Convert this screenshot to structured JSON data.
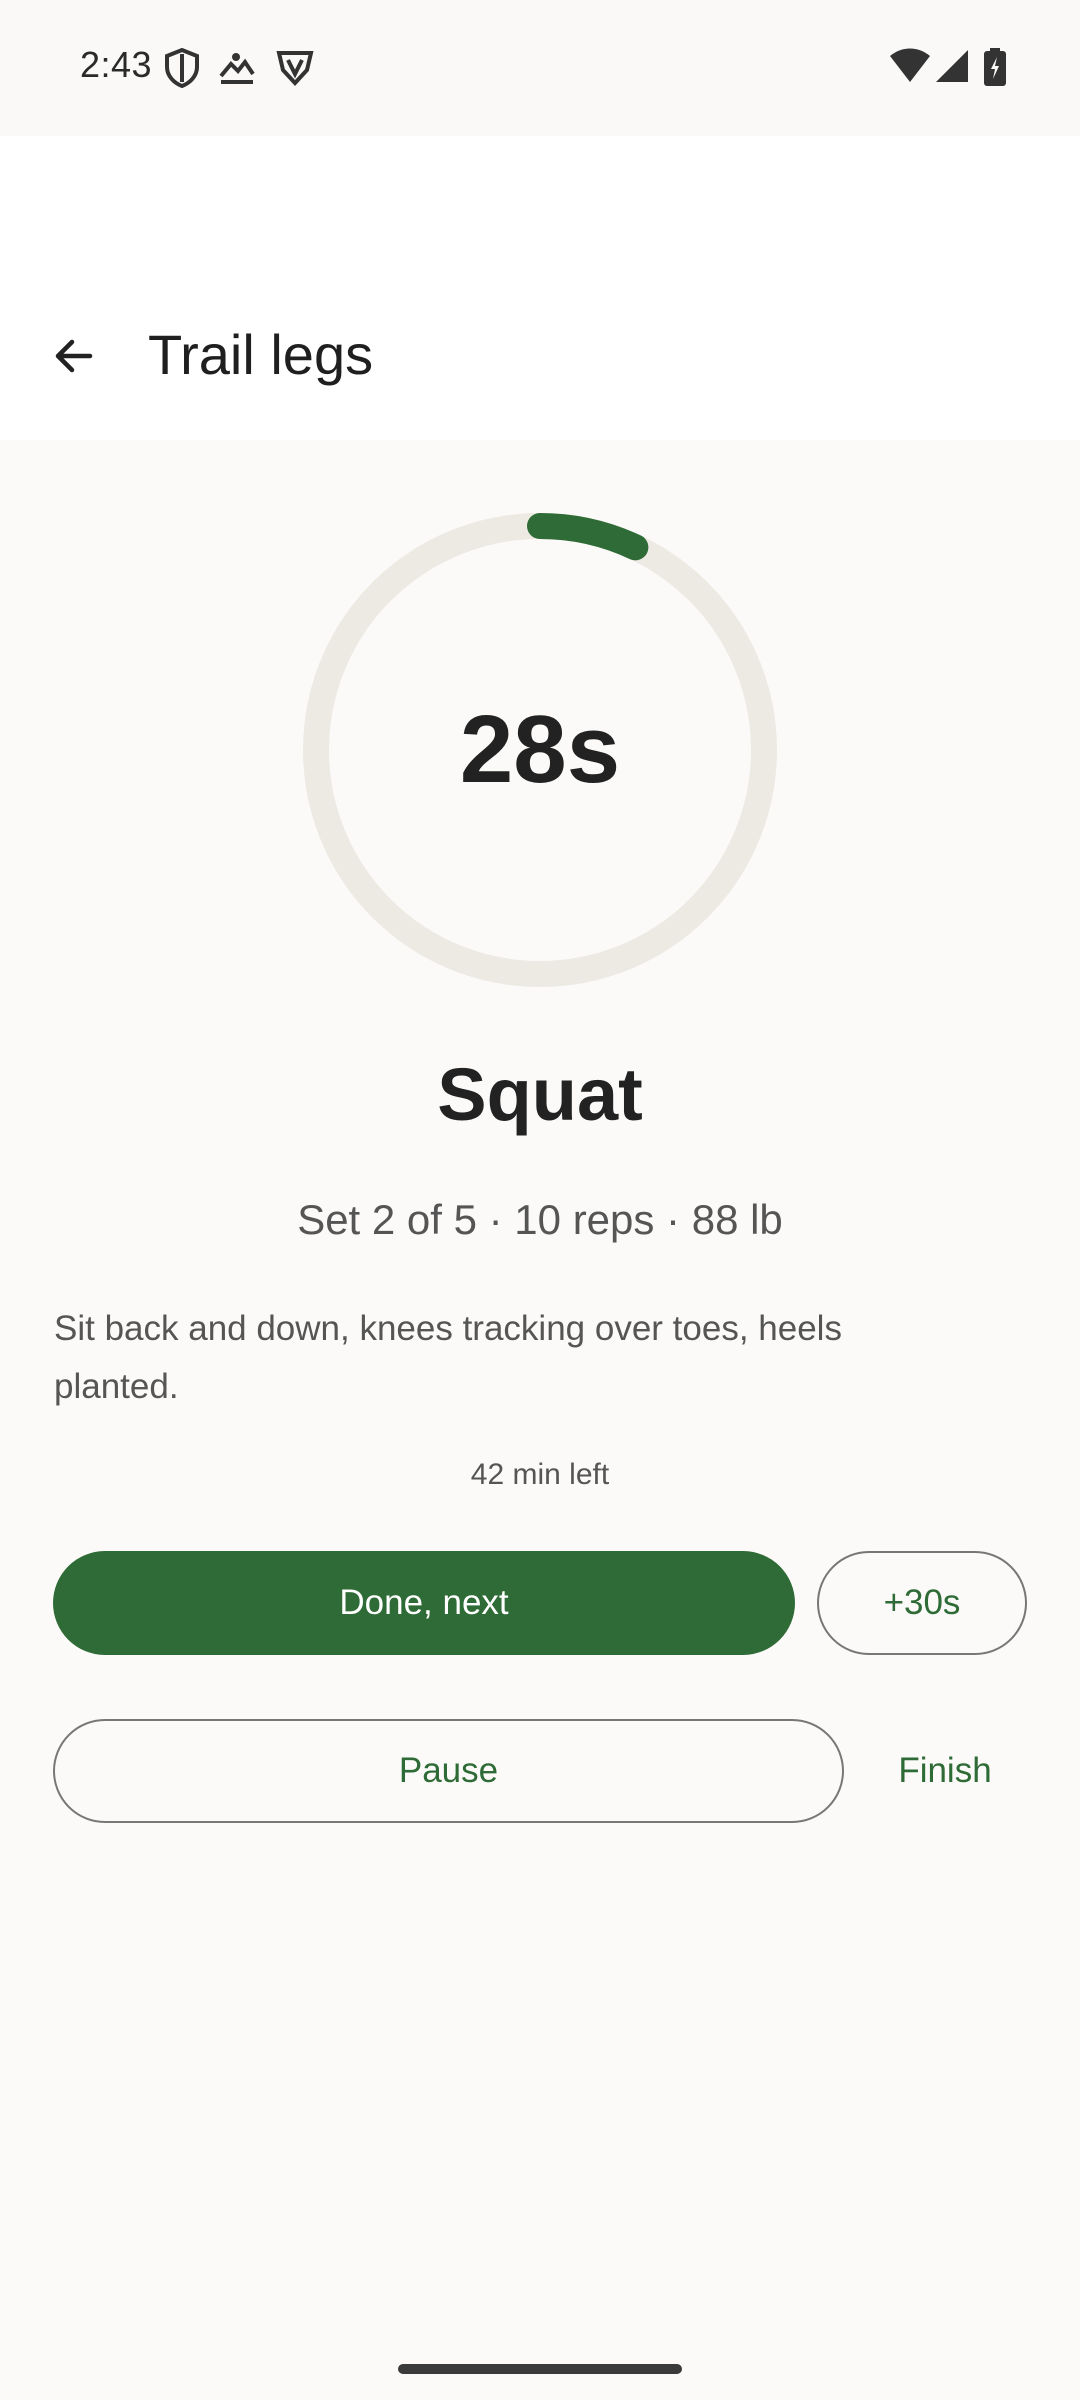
{
  "status_bar": {
    "time": "2:43",
    "left_icons": [
      "shield-icon",
      "gallery-icon",
      "vpn-icon"
    ],
    "right_icons": [
      "wifi-icon",
      "signal-icon",
      "battery-charging-icon"
    ]
  },
  "header": {
    "title": "Trail legs",
    "back_icon": "arrow-back-icon"
  },
  "timer": {
    "value": "28s",
    "progress": 0.07,
    "track_color": "#EDEAE3",
    "progress_color": "#2E6B36"
  },
  "exercise": {
    "name": "Squat",
    "details": "Set 2 of 5 · 10 reps · 88 lb",
    "instructions": "Sit back and down, knees tracking over toes, heels planted.",
    "time_left": "42 min left"
  },
  "actions": {
    "done_next": "Done, next",
    "add_time": "+30s",
    "pause": "Pause",
    "finish": "Finish"
  },
  "colors": {
    "accent": "#2E6B36",
    "background": "#FBFAF8",
    "surface": "#FFFFFF"
  }
}
